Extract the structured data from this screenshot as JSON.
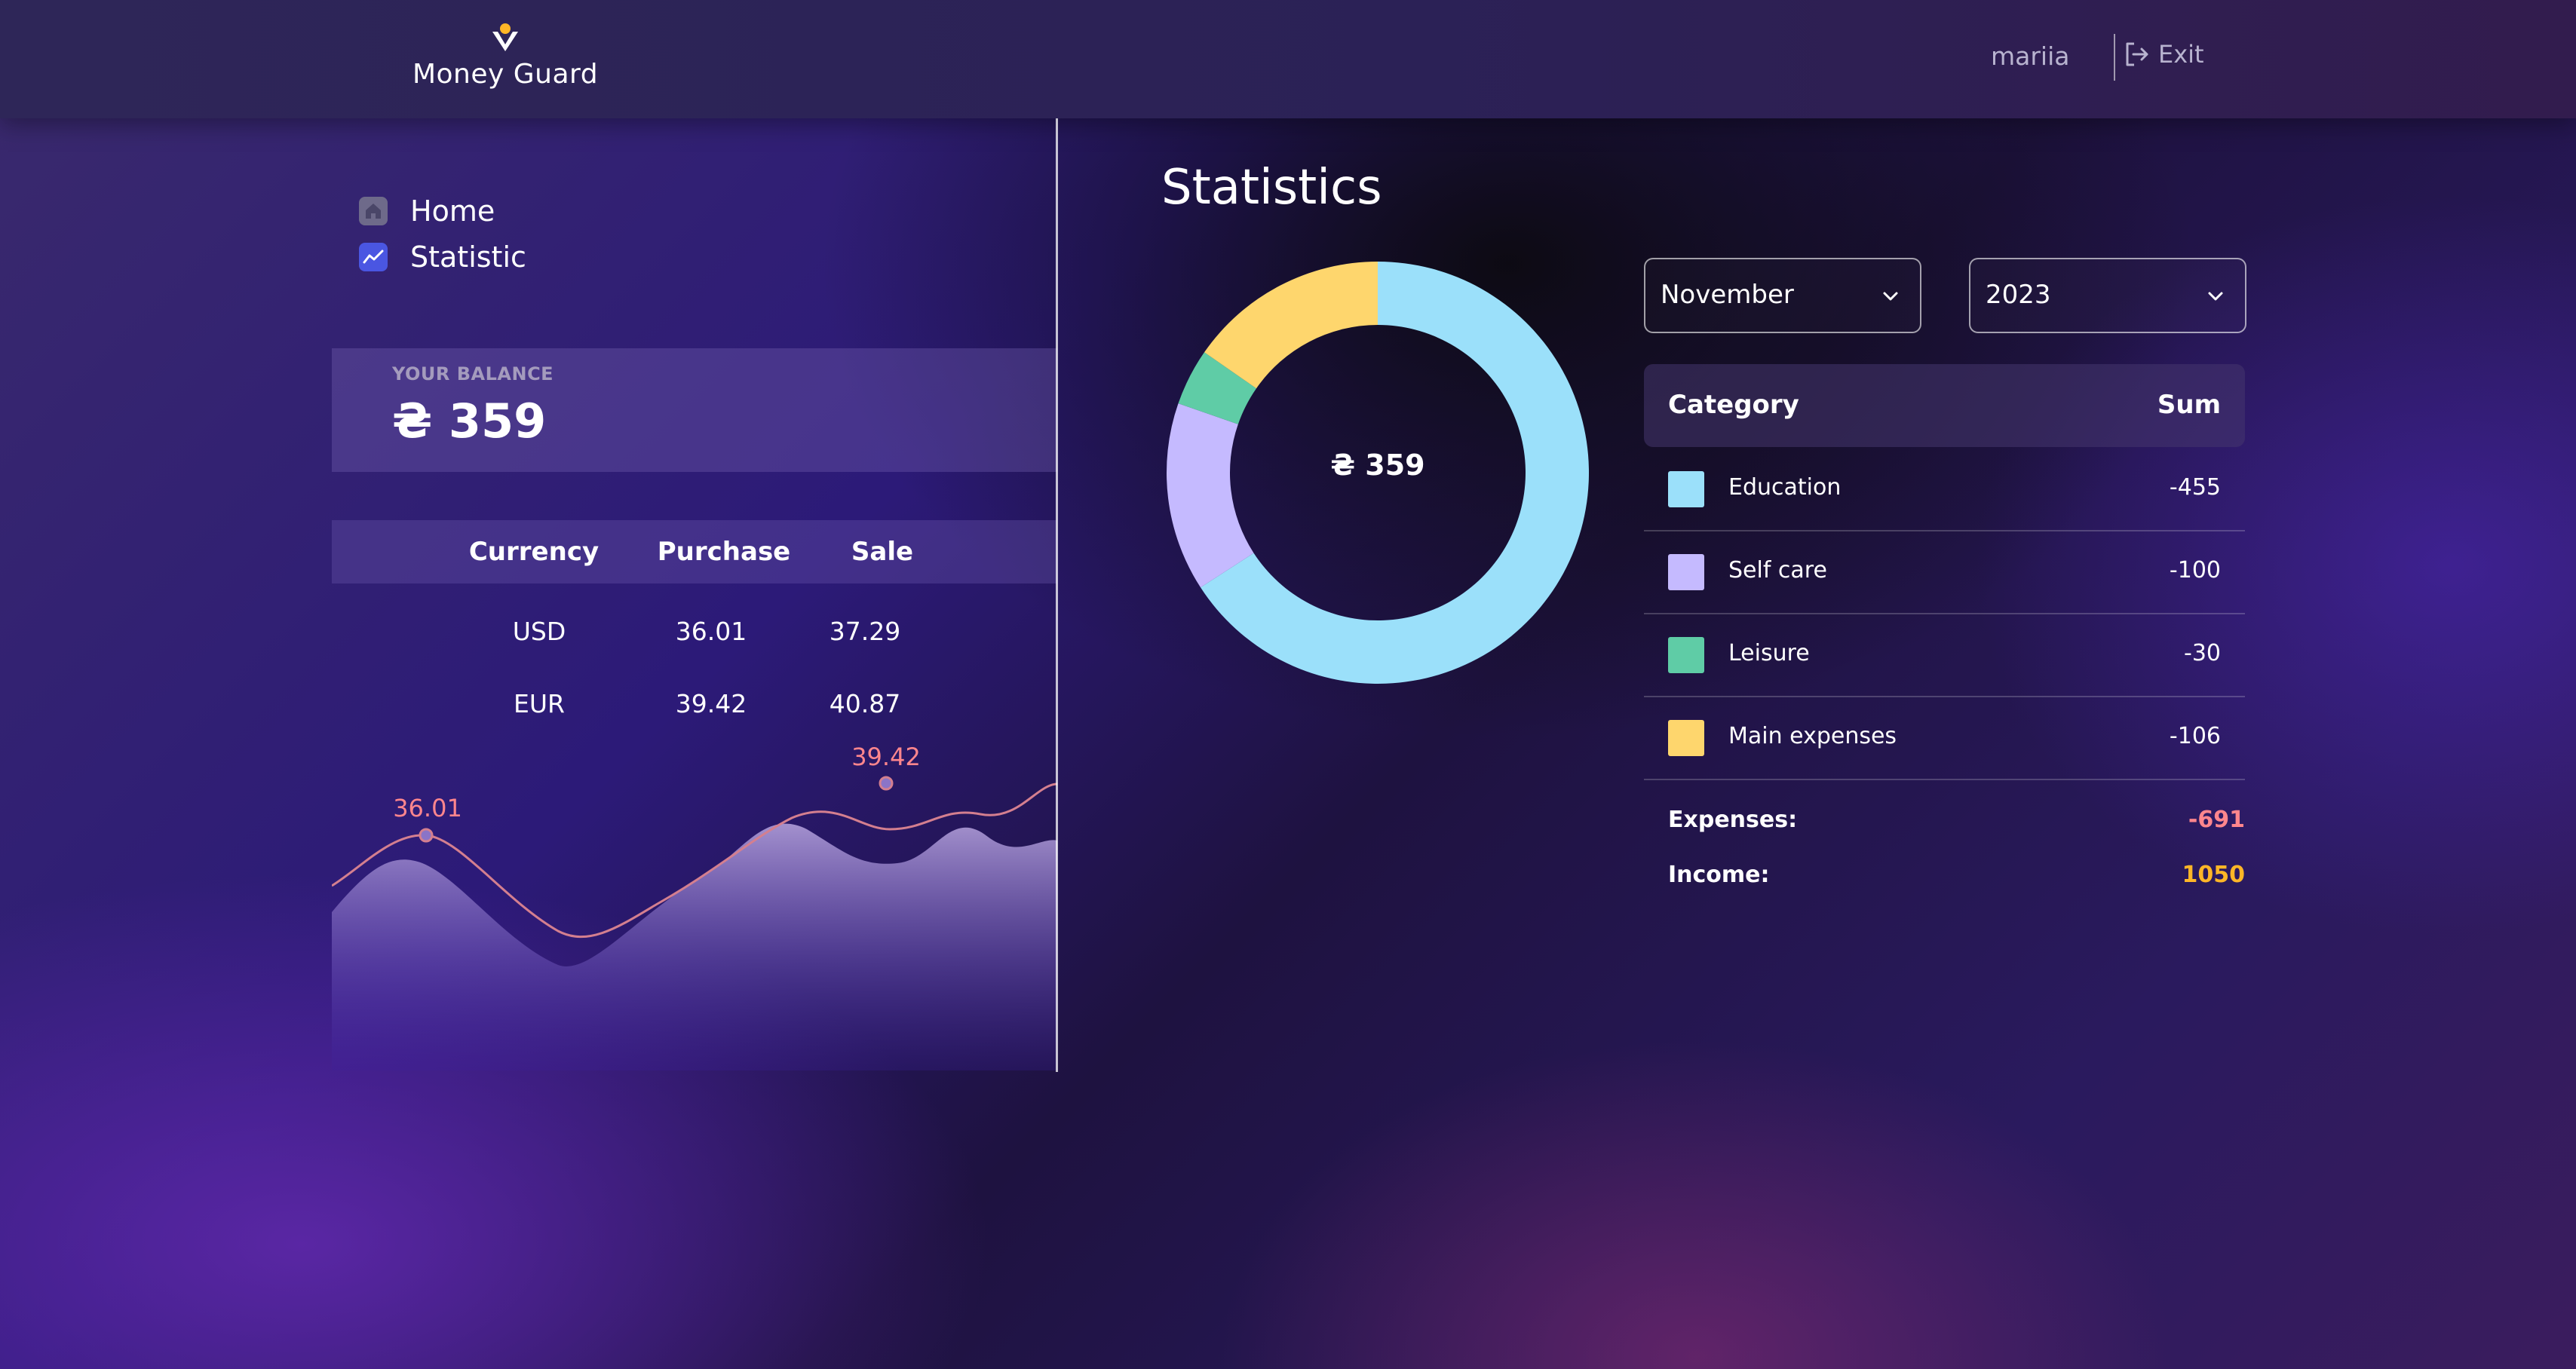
{
  "header": {
    "app_name": "Money Guard",
    "user_name": "mariia",
    "exit_label": "Exit"
  },
  "nav": {
    "items": [
      {
        "label": "Home",
        "icon": "home-icon",
        "active": false
      },
      {
        "label": "Statistic",
        "icon": "chart-icon",
        "active": true
      }
    ]
  },
  "balance": {
    "label": "YOUR BALANCE",
    "value": "₴ 359"
  },
  "currency": {
    "headers": [
      "Currency",
      "Purchase",
      "Sale"
    ],
    "rows": [
      {
        "currency": "USD",
        "purchase": "36.01",
        "sale": "37.29"
      },
      {
        "currency": "EUR",
        "purchase": "39.42",
        "sale": "40.87"
      }
    ],
    "chart_labels": [
      "36.01",
      "39.42"
    ]
  },
  "statistics": {
    "title": "Statistics",
    "center_label": "₴ 359",
    "month": "November",
    "year": "2023",
    "table_headers": {
      "category": "Category",
      "sum": "Sum"
    },
    "categories": [
      {
        "name": "Education",
        "sum": "-455",
        "color": "#9BE0FA"
      },
      {
        "name": "Self care",
        "sum": "-100",
        "color": "#C5BAFF"
      },
      {
        "name": "Leisure",
        "sum": "-30",
        "color": "#5FCCA6"
      },
      {
        "name": "Main expenses",
        "sum": "-106",
        "color": "#FED66D"
      }
    ],
    "expenses_label": "Expenses:",
    "expenses_value": "-691",
    "expenses_color": "#FF868D",
    "income_label": "Income:",
    "income_value": "1050",
    "income_color": "#FFB627"
  },
  "chart_data": {
    "type": "pie",
    "categories": [
      "Education",
      "Self care",
      "Leisure",
      "Main expenses"
    ],
    "values": [
      455,
      100,
      30,
      106
    ],
    "colors": [
      "#9BE0FA",
      "#C5BAFF",
      "#5FCCA6",
      "#FED66D"
    ]
  }
}
